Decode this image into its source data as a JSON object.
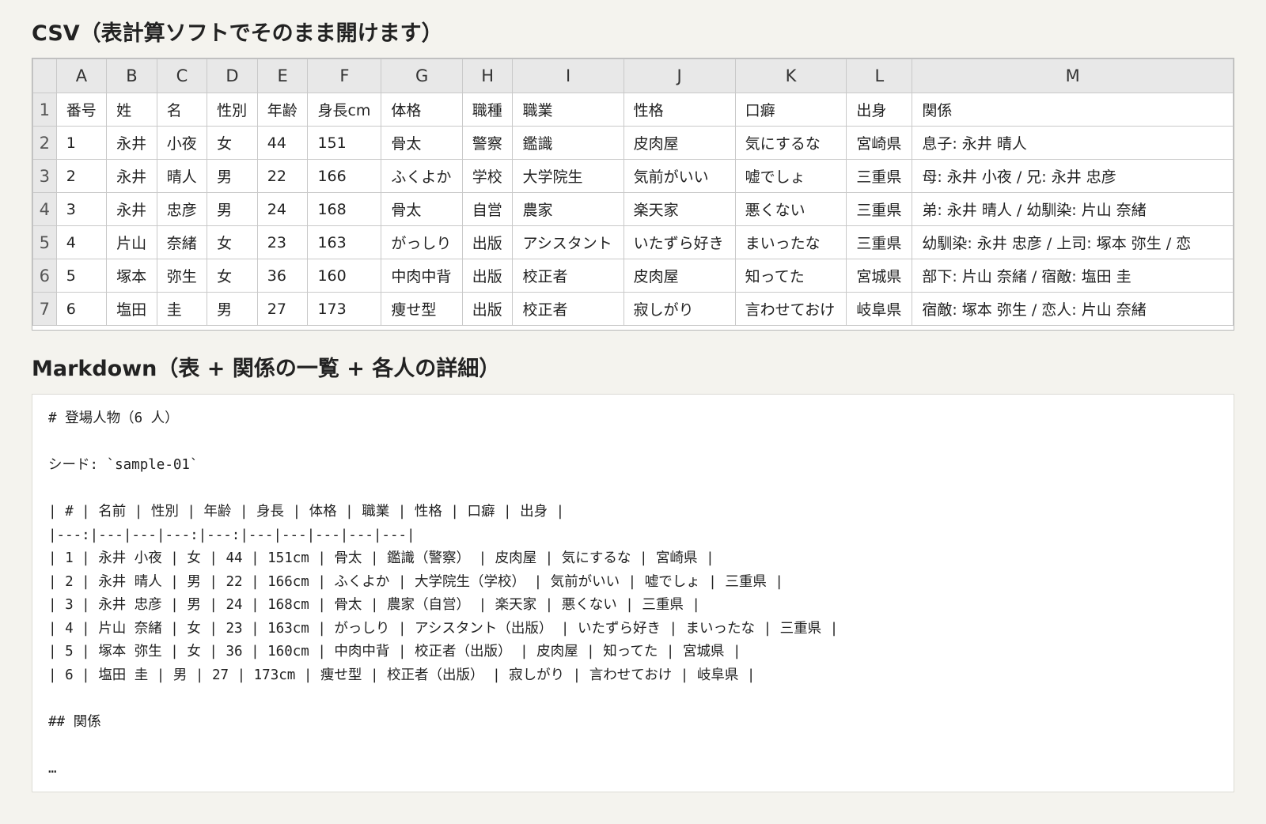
{
  "csv_section": {
    "title": "CSV（表計算ソフトでそのまま開けます）",
    "columns": [
      "A",
      "B",
      "C",
      "D",
      "E",
      "F",
      "G",
      "H",
      "I",
      "J",
      "K",
      "L",
      "M"
    ],
    "rows": [
      {
        "num": "1",
        "cells": [
          "番号",
          "姓",
          "名",
          "性別",
          "年齢",
          "身長cm",
          "体格",
          "職種",
          "職業",
          "性格",
          "口癖",
          "出身",
          "関係"
        ]
      },
      {
        "num": "2",
        "cells": [
          "1",
          "永井",
          "小夜",
          "女",
          "44",
          "151",
          "骨太",
          "警察",
          "鑑識",
          "皮肉屋",
          "気にするな",
          "宮崎県",
          "息子: 永井 晴人"
        ]
      },
      {
        "num": "3",
        "cells": [
          "2",
          "永井",
          "晴人",
          "男",
          "22",
          "166",
          "ふくよか",
          "学校",
          "大学院生",
          "気前がいい",
          "嘘でしょ",
          "三重県",
          "母: 永井 小夜 / 兄: 永井 忠彦"
        ]
      },
      {
        "num": "4",
        "cells": [
          "3",
          "永井",
          "忠彦",
          "男",
          "24",
          "168",
          "骨太",
          "自営",
          "農家",
          "楽天家",
          "悪くない",
          "三重県",
          "弟: 永井 晴人 / 幼馴染: 片山 奈緒"
        ]
      },
      {
        "num": "5",
        "cells": [
          "4",
          "片山",
          "奈緒",
          "女",
          "23",
          "163",
          "がっしり",
          "出版",
          "アシスタント",
          "いたずら好き",
          "まいったな",
          "三重県",
          "幼馴染: 永井 忠彦 / 上司: 塚本 弥生 / 恋"
        ]
      },
      {
        "num": "6",
        "cells": [
          "5",
          "塚本",
          "弥生",
          "女",
          "36",
          "160",
          "中肉中背",
          "出版",
          "校正者",
          "皮肉屋",
          "知ってた",
          "宮城県",
          "部下: 片山 奈緒 / 宿敵: 塩田 圭"
        ]
      },
      {
        "num": "7",
        "cells": [
          "6",
          "塩田",
          "圭",
          "男",
          "27",
          "173",
          "痩せ型",
          "出版",
          "校正者",
          "寂しがり",
          "言わせておけ",
          "岐阜県",
          "宿敵: 塚本 弥生 / 恋人: 片山 奈緒"
        ]
      }
    ]
  },
  "markdown_section": {
    "title": "Markdown（表 + 関係の一覧 + 各人の詳細）",
    "lines": [
      "# 登場人物（6 人）",
      "",
      "シード: `sample-01`",
      "",
      "| # | 名前 | 性別 | 年齢 | 身長 | 体格 | 職業 | 性格 | 口癖 | 出身 |",
      "|---:|---|---|---:|---:|---|---|---|---|---|",
      "| 1 | 永井 小夜 | 女 | 44 | 151cm | 骨太 | 鑑識（警察） | 皮肉屋 | 気にするな | 宮崎県 |",
      "| 2 | 永井 晴人 | 男 | 22 | 166cm | ふくよか | 大学院生（学校） | 気前がいい | 嘘でしょ | 三重県 |",
      "| 3 | 永井 忠彦 | 男 | 24 | 168cm | 骨太 | 農家（自営） | 楽天家 | 悪くない | 三重県 |",
      "| 4 | 片山 奈緒 | 女 | 23 | 163cm | がっしり | アシスタント（出版） | いたずら好き | まいったな | 三重県 |",
      "| 5 | 塚本 弥生 | 女 | 36 | 160cm | 中肉中背 | 校正者（出版） | 皮肉屋 | 知ってた | 宮城県 |",
      "| 6 | 塩田 圭 | 男 | 27 | 173cm | 痩せ型 | 校正者（出版） | 寂しがり | 言わせておけ | 岐阜県 |",
      "",
      "## 関係",
      "",
      "…"
    ]
  }
}
